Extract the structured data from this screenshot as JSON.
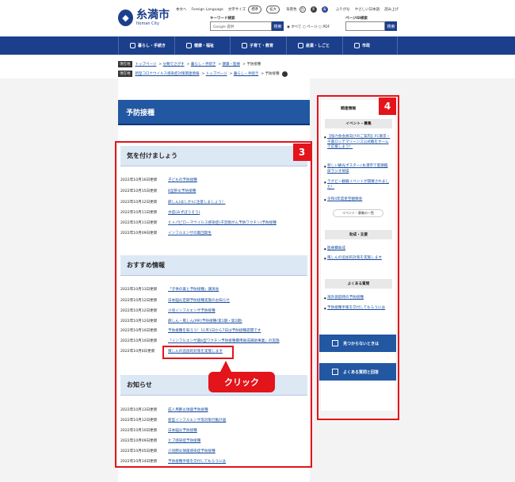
{
  "header": {
    "city_jp": "糸満市",
    "city_en": "Itoman City",
    "util": [
      "本文へ",
      "Foreign Language",
      "文字サイズ",
      "標準",
      "拡大",
      "背景色",
      "白",
      "黒",
      "青",
      "ふりがな",
      "やさしい日本語",
      "読み上げ"
    ],
    "kw_label": "キーワード検索",
    "kw_placeholder": "Google 提供",
    "search_btn": "検索",
    "pid_label": "ページID検索",
    "pid_btn": "検索",
    "radios": [
      "すべて",
      "ページ",
      "PDF"
    ]
  },
  "nav": [
    "暮らし・手続き",
    "健康・福祉",
    "子育て・教育",
    "産業・しごと",
    "市政"
  ],
  "breadcrumb1": {
    "tag": "現在地",
    "items": [
      "トップページ",
      "分類でさがす",
      "暮らし・手続き",
      "健康・医療",
      "予防接種"
    ]
  },
  "breadcrumb2": {
    "tag": "現在地",
    "items": [
      "新型コロナウイルス感染症対策関連情報",
      "トップページ",
      "暮らし・手続き",
      "予防接種"
    ]
  },
  "page_title": "予防接種",
  "sections": [
    {
      "title": "気を付けましょう",
      "rows": [
        {
          "date": "2022年10月16日更新",
          "text": "子どもの予防接種"
        },
        {
          "date": "2022年10月15日更新",
          "text": "B型肝炎予防接種"
        },
        {
          "date": "2022年10月12日更新",
          "text": "麻しん(はしか)に注意しましょう！"
        },
        {
          "date": "2022年10月11日更新",
          "text": "水痘(みずぼうそう)"
        },
        {
          "date": "2022年10月11日更新",
          "text": "ヒトパピローマウイルス感染症(子宮頸がん予防ワクチン)予防接種"
        },
        {
          "date": "2022年10月09日更新",
          "text": "インフルエンザの集団発生"
        }
      ]
    },
    {
      "title": "おすすめ情報",
      "rows": [
        {
          "date": "2022年10月13日更新",
          "text": "「子供の薬と予防接種」講演会"
        },
        {
          "date": "2022年10月12日更新",
          "text": "日本脳炎定期予防接種実施のお知らせ"
        },
        {
          "date": "2022年10月12日更新",
          "text": "小児インフルエンザ予防接種"
        },
        {
          "date": "2022年10月12日更新",
          "text": "麻しん・風しん(MR)予防接種(第1期・第2期)"
        },
        {
          "date": "2022年10月10日更新",
          "text": "予防接種を知ろう！11月1日から7日は予防接種週間です"
        },
        {
          "date": "2022年10月10日更新",
          "text": "「インフルエンザ菌b型ワクチン予防接種費用助成補助事業」の実施"
        },
        {
          "date": "2022年10月6日更新",
          "text": "風しんの追加的対策を実施します"
        }
      ]
    },
    {
      "title": "お知らせ",
      "rows": [
        {
          "date": "2022年10月13日更新",
          "text": "成人用肺炎球菌予防接種"
        },
        {
          "date": "2022年10月12日更新",
          "text": "新型インフルエンザ等対策行動計画"
        },
        {
          "date": "2022年10月10日更新",
          "text": "日本脳炎予防接種"
        },
        {
          "date": "2022年10月09日更新",
          "text": "ヒブ感染症予防接種"
        },
        {
          "date": "2022年10月05日更新",
          "text": "小児肺炎球菌感染症予防接種"
        },
        {
          "date": "2022年10月14日更新",
          "text": "予防接種手帳を交付してもらうには"
        }
      ]
    }
  ],
  "sidebar": {
    "title": "関連情報",
    "event_h": "イベント・募集",
    "events": [
      "【協力会会員向けのご案内】FC東京・千葉ロッテマリーンズ公式戦をホームで応援しよう！",
      "新しい観光ポスター♪糸満市で夏期臨床ラジオ体操",
      "ラグビー観戦イベントが開催されました！",
      "令和4年度星空観察会"
    ],
    "event_more": "イベント・募集の一覧",
    "grant_h": "助成・支援",
    "grants": [
      "医療費助成",
      "風しんの追加的対策を実施します"
    ],
    "faq_h": "よくある質問",
    "faqs": [
      "海外渡航時の予防接種",
      "予防接種手帳を交付してもらうには"
    ],
    "btn1": "見つからないときは",
    "btn2": "よくある質問と回答"
  },
  "annotations": {
    "badge3": "3",
    "badge4": "4",
    "click": "クリック"
  },
  "colors": {
    "accent": "#2257a2",
    "nav": "#1c3f8c",
    "highlight": "#e4141b"
  }
}
